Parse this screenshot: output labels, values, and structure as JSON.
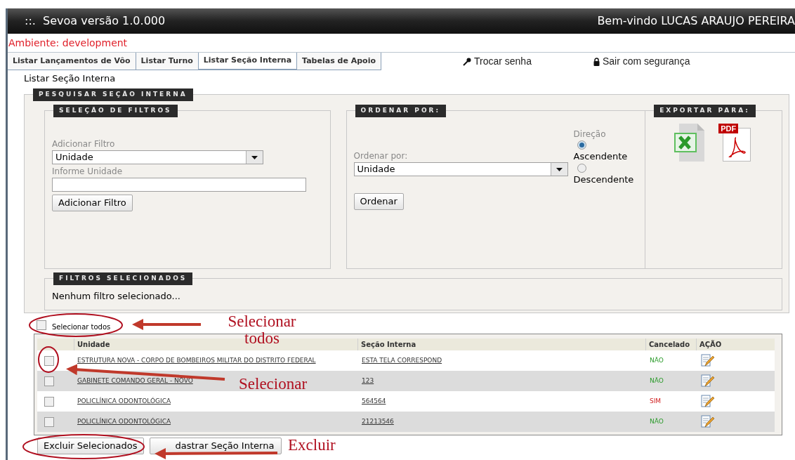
{
  "header": {
    "title": "::.  Sevoa versão 1.0.000",
    "welcome": "Bem-vindo LUCAS ARAUJO PEREIRA"
  },
  "environment": "Ambiente: development",
  "tabs": [
    {
      "label": "Listar Lançamentos de Vôo",
      "selected": false
    },
    {
      "label": "Listar Turno",
      "selected": false
    },
    {
      "label": "Listar Seção Interna",
      "selected": true
    },
    {
      "label": "Tabelas de Apoio",
      "selected": false
    }
  ],
  "links": [
    {
      "kind": "key",
      "label": "Trocar senha"
    },
    {
      "kind": "lock",
      "label": "Sair com segurança"
    }
  ],
  "breadcrumb": "Listar Seção Interna",
  "search": {
    "legend": "PESQUISAR SEÇÃO INTERNA",
    "filters": {
      "legend": "SELEÇÃO DE FILTROS",
      "add_label": "Adicionar Filtro",
      "add_value": "Unidade",
      "input_label": "Informe Unidade",
      "button": "Adicionar Filtro"
    },
    "order": {
      "legend": "ORDENAR POR:",
      "label": "Ordenar por:",
      "value": "Unidade",
      "direction_label": "Direção",
      "directions": [
        {
          "label": "Ascendente",
          "selected": true
        },
        {
          "label": "Descendente",
          "selected": false
        }
      ],
      "button": "Ordenar"
    },
    "export": {
      "legend": "EXPORTAR PARA:",
      "formats": [
        {
          "kind": "excel"
        },
        {
          "kind": "pdf",
          "badge": "PDF"
        }
      ]
    },
    "selected_filters": {
      "legend": "FILTROS SELECIONADOS",
      "text": "Nenhum filtro selecionado..."
    }
  },
  "select_all": {
    "label": "Selecionar todos",
    "checked": false
  },
  "table": {
    "columns": [
      "Unidade",
      "Seção Interna",
      "Cancelado",
      "AÇÃO"
    ],
    "rows": [
      {
        "checked": false,
        "unidade": "ESTRUTURA NOVA - CORPO DE BOMBEIROS MILITAR DO DISTRITO FEDERAL",
        "secao": "ESTA TELA CORRESPOND",
        "cancelado": "NÃO",
        "cancelled": false
      },
      {
        "checked": false,
        "unidade": "GABINETE COMANDO GERAL - NOVO",
        "secao": "123",
        "cancelado": "NÃO",
        "cancelled": false
      },
      {
        "checked": false,
        "unidade": "POLICLÍNICA ODONTOLÓGICA",
        "secao": "564564",
        "cancelado": "SIM",
        "cancelled": true
      },
      {
        "checked": false,
        "unidade": "POLICLÍNICA ODONTOLÓGICA",
        "secao": "21213546",
        "cancelado": "NÃO",
        "cancelled": false
      }
    ]
  },
  "buttons": [
    "Excluir Selecionados",
    "dastrar Seção Interna"
  ],
  "annotations": [
    {
      "text": "Selecionar todos"
    },
    {
      "text": "Selecionar"
    },
    {
      "text": "Excluir"
    }
  ]
}
